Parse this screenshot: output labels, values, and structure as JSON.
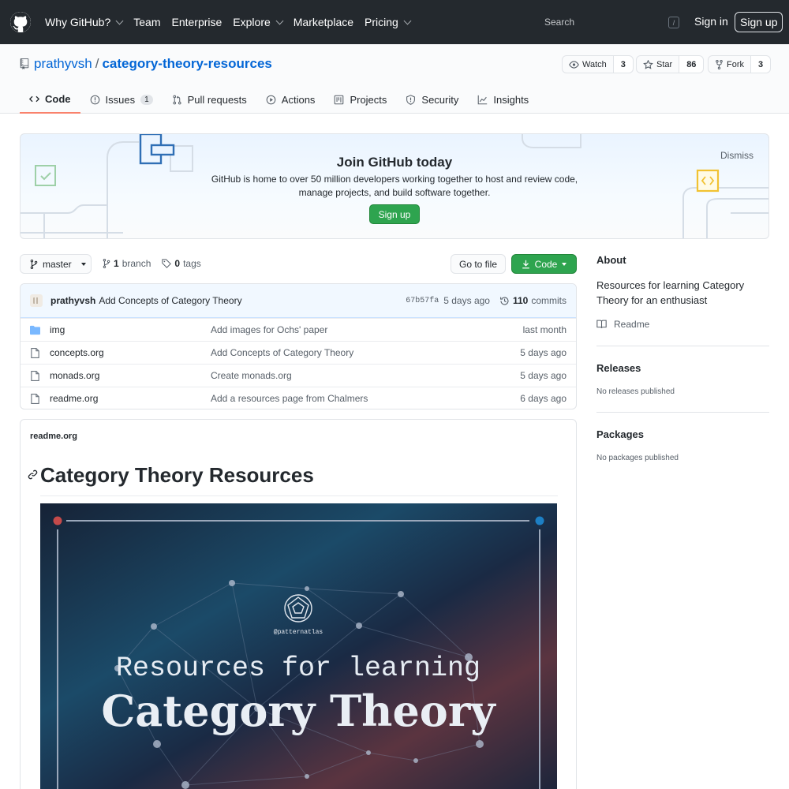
{
  "header": {
    "nav": [
      {
        "label": "Why GitHub?",
        "caret": true
      },
      {
        "label": "Team",
        "caret": false
      },
      {
        "label": "Enterprise",
        "caret": false
      },
      {
        "label": "Explore",
        "caret": true
      },
      {
        "label": "Marketplace",
        "caret": false
      },
      {
        "label": "Pricing",
        "caret": true
      }
    ],
    "search_placeholder": "Search",
    "search_shortcut": "/",
    "sign_in": "Sign in",
    "sign_up": "Sign up"
  },
  "repo": {
    "owner": "prathyvsh",
    "separator": "/",
    "name": "category-theory-resources",
    "watch_label": "Watch",
    "watch_count": "3",
    "star_label": "Star",
    "star_count": "86",
    "fork_label": "Fork",
    "fork_count": "3"
  },
  "tabs": [
    {
      "label": "Code",
      "icon": "code-icon",
      "counter": ""
    },
    {
      "label": "Issues",
      "icon": "issue-icon",
      "counter": "1"
    },
    {
      "label": "Pull requests",
      "icon": "pull-request-icon",
      "counter": ""
    },
    {
      "label": "Actions",
      "icon": "play-icon",
      "counter": ""
    },
    {
      "label": "Projects",
      "icon": "project-icon",
      "counter": ""
    },
    {
      "label": "Security",
      "icon": "shield-icon",
      "counter": ""
    },
    {
      "label": "Insights",
      "icon": "graph-icon",
      "counter": ""
    }
  ],
  "banner": {
    "title": "Join GitHub today",
    "text_line1": "GitHub is home to over 50 million developers working together to host and review code,",
    "text_line2": "manage projects, and build software together.",
    "button": "Sign up",
    "dismiss": "Dismiss"
  },
  "file_nav": {
    "branch": "master",
    "branch_count": "1",
    "branch_word": "branch",
    "tag_count": "0",
    "tag_word": "tags",
    "go_to_file": "Go to file",
    "code_button": "Code"
  },
  "commit": {
    "author": "prathyvsh",
    "message": "Add Concepts of Category Theory",
    "sha": "67b57fa",
    "age": "5 days ago",
    "commit_count": "110",
    "commit_word": "commits"
  },
  "files": [
    {
      "type": "folder",
      "name": "img",
      "message": "Add images for Ochs' paper",
      "age": "last month"
    },
    {
      "type": "file",
      "name": "concepts.org",
      "message": "Add Concepts of Category Theory",
      "age": "5 days ago"
    },
    {
      "type": "file",
      "name": "monads.org",
      "message": "Create monads.org",
      "age": "5 days ago"
    },
    {
      "type": "file",
      "name": "readme.org",
      "message": "Add a resources page from Chalmers",
      "age": "6 days ago"
    }
  ],
  "readme": {
    "filename": "readme.org",
    "heading": "Category Theory Resources",
    "hero": {
      "handle": "@patternatlas",
      "line1": "Resources for learning",
      "line2": "Category Theory"
    }
  },
  "sidebar": {
    "about_title": "About",
    "description": "Resources for learning Category Theory for an enthusiast",
    "readme_link": "Readme",
    "releases_title": "Releases",
    "releases_note": "No releases published",
    "packages_title": "Packages",
    "packages_note": "No packages published"
  },
  "colors": {
    "header_bg": "#24292e",
    "link": "#0366d6",
    "primary_button": "#2ea44f",
    "active_tab_underline": "#f9826c",
    "hero_bg": "#172338"
  }
}
